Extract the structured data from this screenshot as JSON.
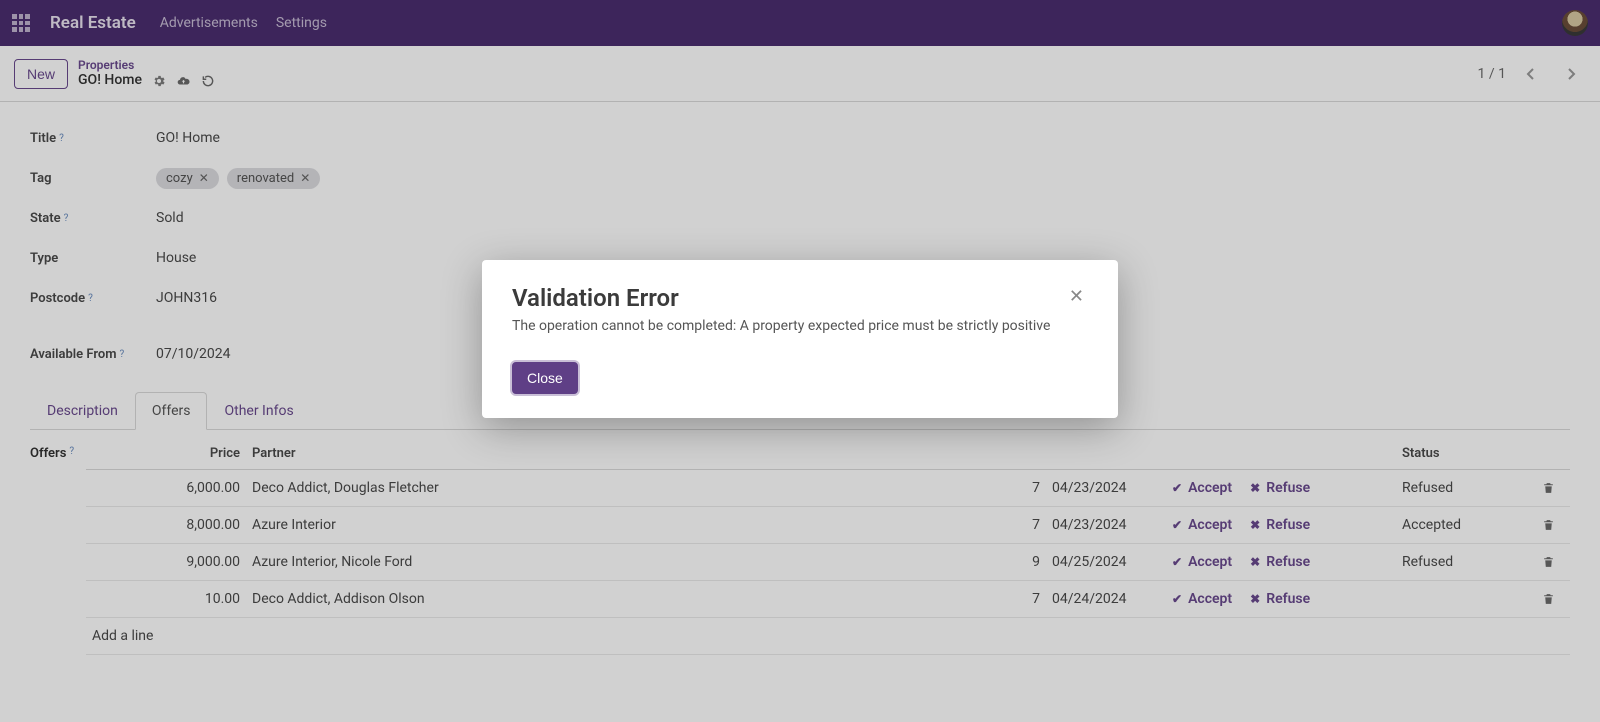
{
  "navbar": {
    "brand": "Real Estate",
    "links": [
      "Advertisements",
      "Settings"
    ]
  },
  "toolbar": {
    "new_label": "New",
    "breadcrumb_top": "Properties",
    "breadcrumb_current": "GO! Home",
    "pager_text": "1 / 1"
  },
  "form": {
    "labels": {
      "title": "Title",
      "tag": "Tag",
      "state": "State",
      "type": "Type",
      "postcode": "Postcode",
      "available_from": "Available From"
    },
    "title": "GO! Home",
    "tags": [
      "cozy",
      "renovated"
    ],
    "state": "Sold",
    "type": "House",
    "postcode": "JOHN316",
    "available_from": "07/10/2024",
    "help_marker": "?"
  },
  "tabs": {
    "description": "Description",
    "offers": "Offers",
    "other_infos": "Other Infos"
  },
  "offers": {
    "label": "Offers",
    "help_marker": "?",
    "columns": {
      "price": "Price",
      "partner": "Partner",
      "validity": "",
      "deadline": "",
      "actions": "",
      "status": "Status"
    },
    "accept_label": "Accept",
    "refuse_label": "Refuse",
    "add_line_label": "Add a line",
    "rows": [
      {
        "price": "6,000.00",
        "partner": "Deco Addict, Douglas Fletcher",
        "validity": "7",
        "deadline": "04/23/2024",
        "status": "Refused"
      },
      {
        "price": "8,000.00",
        "partner": "Azure Interior",
        "validity": "7",
        "deadline": "04/23/2024",
        "status": "Accepted"
      },
      {
        "price": "9,000.00",
        "partner": "Azure Interior, Nicole Ford",
        "validity": "9",
        "deadline": "04/25/2024",
        "status": "Refused"
      },
      {
        "price": "10.00",
        "partner": "Deco Addict, Addison Olson",
        "validity": "7",
        "deadline": "04/24/2024",
        "status": ""
      }
    ]
  },
  "modal": {
    "title": "Validation Error",
    "message": "The operation cannot be completed: A property expected price must be strictly positive",
    "close_label": "Close"
  }
}
